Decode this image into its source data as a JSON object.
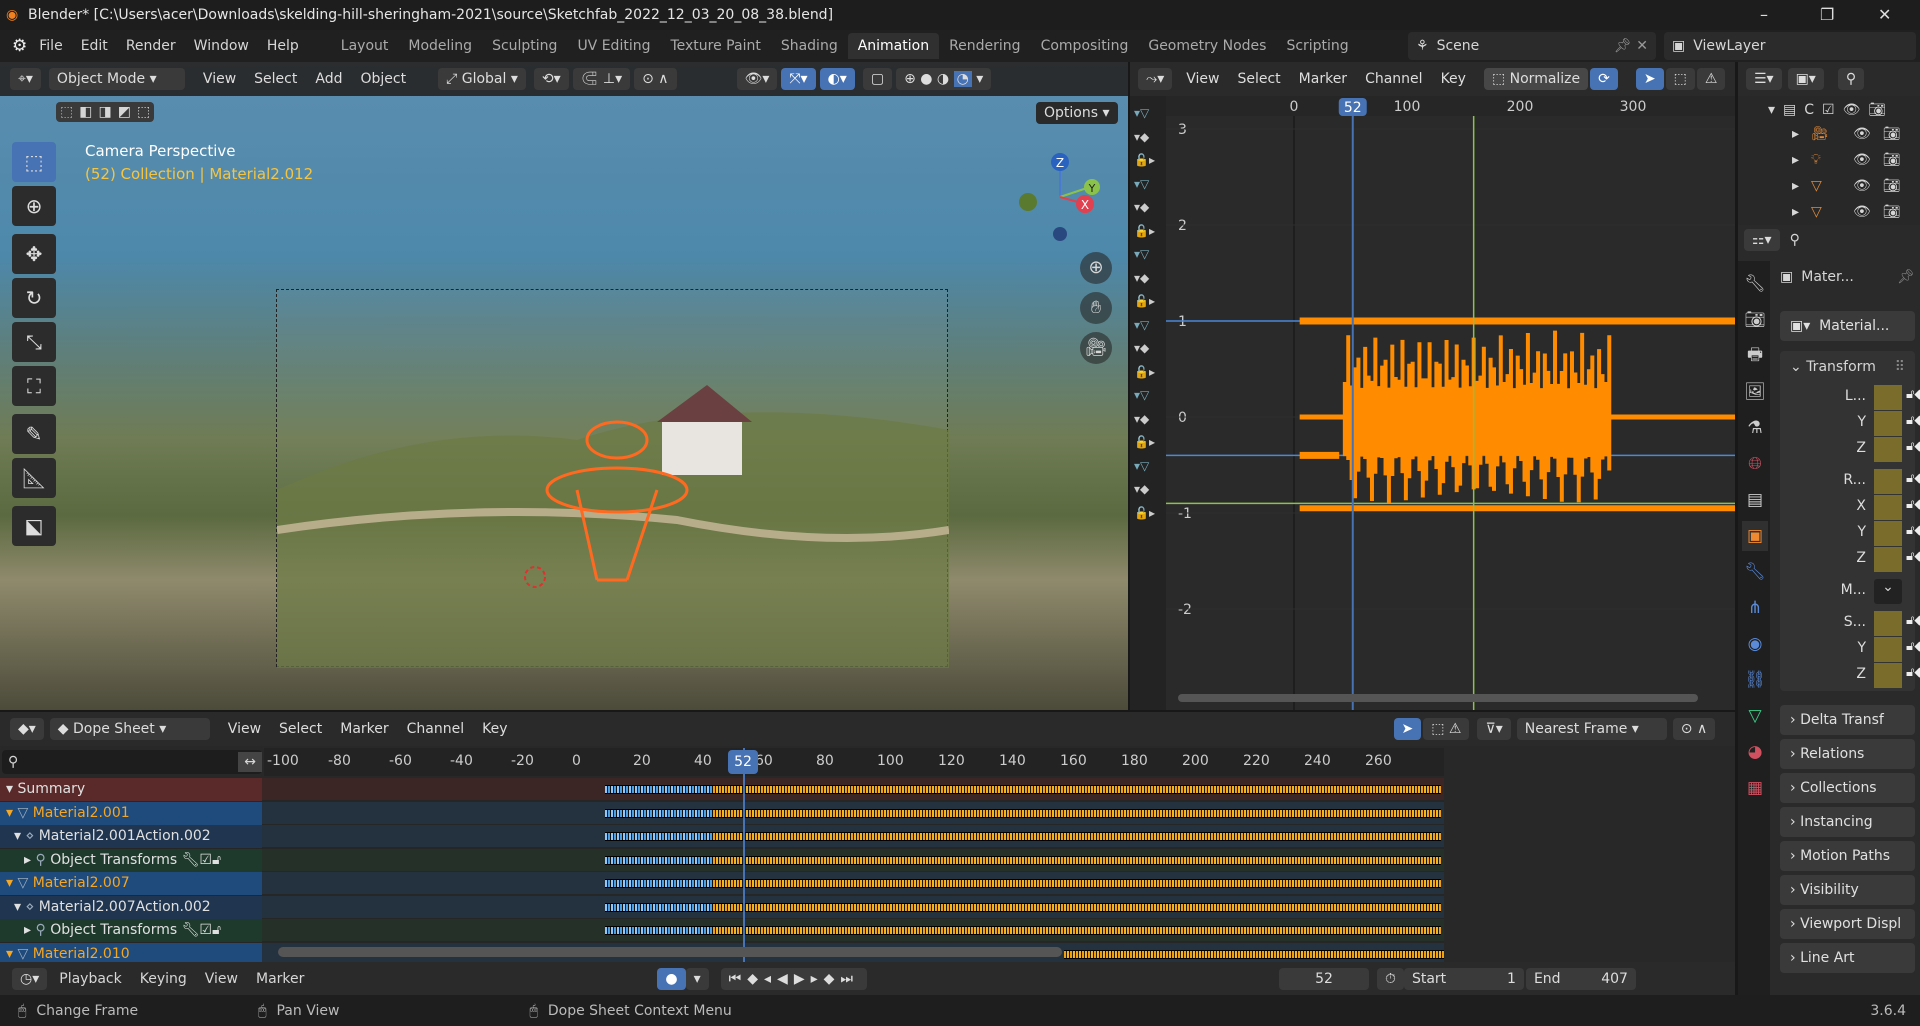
{
  "title": "Blender* [C:\\Users\\acer\\Downloads\\skelding-hill-sheringham-2021\\source\\Sketchfab_2022_12_03_20_08_38.blend]",
  "window_controls": {
    "minimize": "–",
    "maximize": "❐",
    "close": "✕"
  },
  "menu": [
    "File",
    "Edit",
    "Render",
    "Window",
    "Help"
  ],
  "workspaces": [
    "Layout",
    "Modeling",
    "Sculpting",
    "UV Editing",
    "Texture Paint",
    "Shading",
    "Animation",
    "Rendering",
    "Compositing",
    "Geometry Nodes",
    "Scripting"
  ],
  "active_workspace": "Animation",
  "scene": "Scene",
  "view_layer": "ViewLayer",
  "viewport": {
    "mode": "Object Mode",
    "menus": [
      "View",
      "Select",
      "Add",
      "Object"
    ],
    "orientation": "Global",
    "options": "Options",
    "overlay_title": "Camera Perspective",
    "overlay_sub": "(52) Collection | Material2.012",
    "gizmo": {
      "z": "Z",
      "y": "Y",
      "x": "X"
    }
  },
  "graph": {
    "menus": [
      "View",
      "Select",
      "Marker",
      "Channel",
      "Key"
    ],
    "normalize": "Normalize",
    "x_ticks": [
      "0",
      "100",
      "200",
      "300"
    ],
    "current_frame": "52",
    "y_ticks": [
      "3",
      "2",
      "1",
      "0",
      "-1",
      "-2"
    ]
  },
  "dopesheet": {
    "mode": "Dope Sheet",
    "menus": [
      "View",
      "Select",
      "Marker",
      "Channel",
      "Key"
    ],
    "snap": "Nearest Frame",
    "ticks": [
      "-100",
      "-80",
      "-60",
      "-40",
      "-20",
      "0",
      "20",
      "40",
      "60",
      "80",
      "100",
      "120",
      "140",
      "160",
      "180",
      "200",
      "220",
      "240",
      "260"
    ],
    "current_frame": "52",
    "channels": [
      {
        "label": "Summary",
        "type": "summary"
      },
      {
        "label": "Material2.001",
        "type": "object"
      },
      {
        "label": "Material2.001Action.002",
        "type": "action"
      },
      {
        "label": "Object Transforms",
        "type": "group"
      },
      {
        "label": "Material2.007",
        "type": "object"
      },
      {
        "label": "Material2.007Action.002",
        "type": "action"
      },
      {
        "label": "Object Transforms",
        "type": "group"
      },
      {
        "label": "Material2.010",
        "type": "object"
      }
    ]
  },
  "timeline": {
    "menus": [
      "Playback",
      "Keying",
      "View",
      "Marker"
    ],
    "frame": "52",
    "start_label": "Start",
    "start": "1",
    "end_label": "End",
    "end": "407"
  },
  "properties": {
    "header": "Mater...",
    "datablock": "Material...",
    "transform": "Transform",
    "rows": [
      {
        "l": "L..."
      },
      {
        "l": "Y"
      },
      {
        "l": "Z"
      },
      {
        "l": "R..."
      },
      {
        "l": "X"
      },
      {
        "l": "Y"
      },
      {
        "l": "Z"
      },
      {
        "l": "M..."
      },
      {
        "l": "S..."
      },
      {
        "l": "Y"
      },
      {
        "l": "Z"
      }
    ],
    "panels": [
      "Delta Transf",
      "Relations",
      "Collections",
      "Instancing",
      "Motion Paths",
      "Visibility",
      "Viewport Displ",
      "Line Art"
    ]
  },
  "outliner": {
    "collection": "C"
  },
  "status": {
    "left": "Change Frame",
    "middle": "Pan View",
    "right": "Dope Sheet Context Menu",
    "version": "3.6.4"
  },
  "colors": {
    "accent": "#4772b3",
    "keyframe": "#f0a010",
    "curve": "#ff8c00",
    "object_text": "#f5a623"
  }
}
